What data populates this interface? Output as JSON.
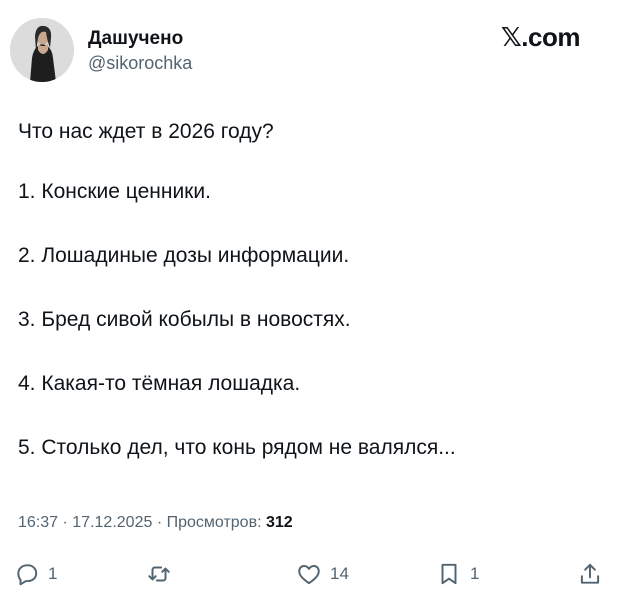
{
  "author": {
    "display_name": "Дашучено",
    "handle": "@sikorochka"
  },
  "brand": "𝕏.com",
  "tweet": {
    "lines": [
      "Что нас ждет в 2026 году?",
      "1. Конские ценники.",
      "2. Лошадиные дозы информации.",
      "3. Бред сивой кобылы в новостях.",
      "4. Какая-то тёмная лошадка.",
      "5. Столько дел, что конь рядом не валялся..."
    ]
  },
  "meta": {
    "time": "16:37",
    "date": "17.12.2025",
    "views_label": "Просмотров:",
    "views_count": "312",
    "separator": "·"
  },
  "actions": {
    "reply": {
      "icon": "reply-icon",
      "count": "1"
    },
    "repost": {
      "icon": "repost-icon",
      "count": ""
    },
    "like": {
      "icon": "like-icon",
      "count": "14"
    },
    "bookmark": {
      "icon": "bookmark-icon",
      "count": "1"
    },
    "share": {
      "icon": "share-icon",
      "count": ""
    }
  }
}
